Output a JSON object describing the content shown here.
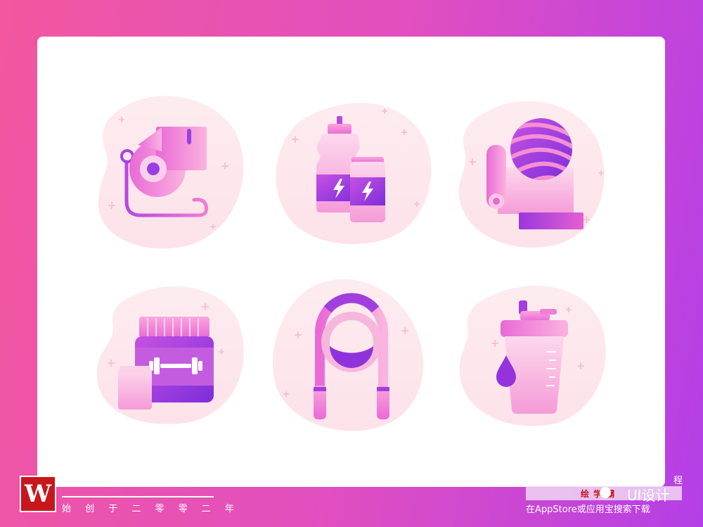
{
  "colors": {
    "background_start": "#f2579f",
    "background_end": "#b43fe7",
    "card": "#ffffff",
    "blob": "#fde6ec",
    "pink": "#f27fd0",
    "light_pink": "#fbc6e4",
    "purple": "#8f34db",
    "accent_red": "#c8161d"
  },
  "icons": [
    {
      "id": "whistle",
      "icon": "whistle-icon"
    },
    {
      "id": "drinks",
      "icon": "water-bottle-and-can-icon"
    },
    {
      "id": "yoga",
      "icon": "yoga-ball-and-mat-icon"
    },
    {
      "id": "protein",
      "icon": "protein-jar-icon"
    },
    {
      "id": "jump_rope",
      "icon": "jump-rope-icon"
    },
    {
      "id": "shaker",
      "icon": "shaker-bottle-icon"
    }
  ],
  "watermark_left": {
    "logo_letter": "W",
    "tagline": "始 创 于 二 零 零 二 年"
  },
  "watermark_right": {
    "corner_text": "程",
    "brand": "绘 学 霸",
    "title": "UI设计",
    "download_text": "在AppStore或应用宝搜索下载"
  }
}
